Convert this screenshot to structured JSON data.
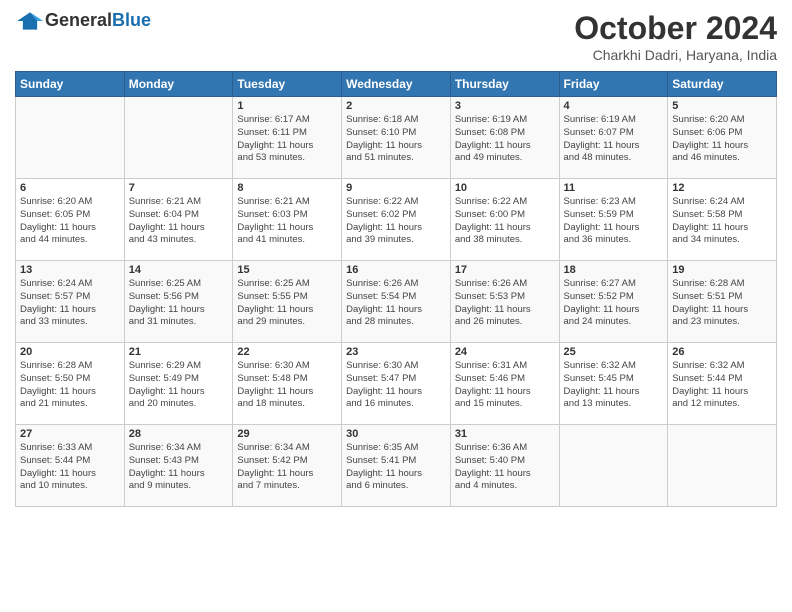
{
  "header": {
    "logo_general": "General",
    "logo_blue": "Blue",
    "title": "October 2024",
    "location": "Charkhi Dadri, Haryana, India"
  },
  "weekdays": [
    "Sunday",
    "Monday",
    "Tuesday",
    "Wednesday",
    "Thursday",
    "Friday",
    "Saturday"
  ],
  "weeks": [
    [
      {
        "day": "",
        "info": ""
      },
      {
        "day": "",
        "info": ""
      },
      {
        "day": "1",
        "info": "Sunrise: 6:17 AM\nSunset: 6:11 PM\nDaylight: 11 hours\nand 53 minutes."
      },
      {
        "day": "2",
        "info": "Sunrise: 6:18 AM\nSunset: 6:10 PM\nDaylight: 11 hours\nand 51 minutes."
      },
      {
        "day": "3",
        "info": "Sunrise: 6:19 AM\nSunset: 6:08 PM\nDaylight: 11 hours\nand 49 minutes."
      },
      {
        "day": "4",
        "info": "Sunrise: 6:19 AM\nSunset: 6:07 PM\nDaylight: 11 hours\nand 48 minutes."
      },
      {
        "day": "5",
        "info": "Sunrise: 6:20 AM\nSunset: 6:06 PM\nDaylight: 11 hours\nand 46 minutes."
      }
    ],
    [
      {
        "day": "6",
        "info": "Sunrise: 6:20 AM\nSunset: 6:05 PM\nDaylight: 11 hours\nand 44 minutes."
      },
      {
        "day": "7",
        "info": "Sunrise: 6:21 AM\nSunset: 6:04 PM\nDaylight: 11 hours\nand 43 minutes."
      },
      {
        "day": "8",
        "info": "Sunrise: 6:21 AM\nSunset: 6:03 PM\nDaylight: 11 hours\nand 41 minutes."
      },
      {
        "day": "9",
        "info": "Sunrise: 6:22 AM\nSunset: 6:02 PM\nDaylight: 11 hours\nand 39 minutes."
      },
      {
        "day": "10",
        "info": "Sunrise: 6:22 AM\nSunset: 6:00 PM\nDaylight: 11 hours\nand 38 minutes."
      },
      {
        "day": "11",
        "info": "Sunrise: 6:23 AM\nSunset: 5:59 PM\nDaylight: 11 hours\nand 36 minutes."
      },
      {
        "day": "12",
        "info": "Sunrise: 6:24 AM\nSunset: 5:58 PM\nDaylight: 11 hours\nand 34 minutes."
      }
    ],
    [
      {
        "day": "13",
        "info": "Sunrise: 6:24 AM\nSunset: 5:57 PM\nDaylight: 11 hours\nand 33 minutes."
      },
      {
        "day": "14",
        "info": "Sunrise: 6:25 AM\nSunset: 5:56 PM\nDaylight: 11 hours\nand 31 minutes."
      },
      {
        "day": "15",
        "info": "Sunrise: 6:25 AM\nSunset: 5:55 PM\nDaylight: 11 hours\nand 29 minutes."
      },
      {
        "day": "16",
        "info": "Sunrise: 6:26 AM\nSunset: 5:54 PM\nDaylight: 11 hours\nand 28 minutes."
      },
      {
        "day": "17",
        "info": "Sunrise: 6:26 AM\nSunset: 5:53 PM\nDaylight: 11 hours\nand 26 minutes."
      },
      {
        "day": "18",
        "info": "Sunrise: 6:27 AM\nSunset: 5:52 PM\nDaylight: 11 hours\nand 24 minutes."
      },
      {
        "day": "19",
        "info": "Sunrise: 6:28 AM\nSunset: 5:51 PM\nDaylight: 11 hours\nand 23 minutes."
      }
    ],
    [
      {
        "day": "20",
        "info": "Sunrise: 6:28 AM\nSunset: 5:50 PM\nDaylight: 11 hours\nand 21 minutes."
      },
      {
        "day": "21",
        "info": "Sunrise: 6:29 AM\nSunset: 5:49 PM\nDaylight: 11 hours\nand 20 minutes."
      },
      {
        "day": "22",
        "info": "Sunrise: 6:30 AM\nSunset: 5:48 PM\nDaylight: 11 hours\nand 18 minutes."
      },
      {
        "day": "23",
        "info": "Sunrise: 6:30 AM\nSunset: 5:47 PM\nDaylight: 11 hours\nand 16 minutes."
      },
      {
        "day": "24",
        "info": "Sunrise: 6:31 AM\nSunset: 5:46 PM\nDaylight: 11 hours\nand 15 minutes."
      },
      {
        "day": "25",
        "info": "Sunrise: 6:32 AM\nSunset: 5:45 PM\nDaylight: 11 hours\nand 13 minutes."
      },
      {
        "day": "26",
        "info": "Sunrise: 6:32 AM\nSunset: 5:44 PM\nDaylight: 11 hours\nand 12 minutes."
      }
    ],
    [
      {
        "day": "27",
        "info": "Sunrise: 6:33 AM\nSunset: 5:44 PM\nDaylight: 11 hours\nand 10 minutes."
      },
      {
        "day": "28",
        "info": "Sunrise: 6:34 AM\nSunset: 5:43 PM\nDaylight: 11 hours\nand 9 minutes."
      },
      {
        "day": "29",
        "info": "Sunrise: 6:34 AM\nSunset: 5:42 PM\nDaylight: 11 hours\nand 7 minutes."
      },
      {
        "day": "30",
        "info": "Sunrise: 6:35 AM\nSunset: 5:41 PM\nDaylight: 11 hours\nand 6 minutes."
      },
      {
        "day": "31",
        "info": "Sunrise: 6:36 AM\nSunset: 5:40 PM\nDaylight: 11 hours\nand 4 minutes."
      },
      {
        "day": "",
        "info": ""
      },
      {
        "day": "",
        "info": ""
      }
    ]
  ]
}
